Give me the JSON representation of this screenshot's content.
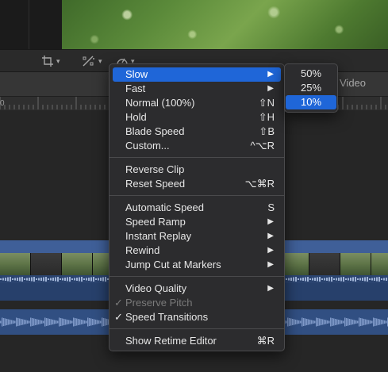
{
  "toolbar": {
    "crop_icon": "crop-icon",
    "transform_icon": "transform-icon",
    "retime_icon": "speedometer-icon"
  },
  "timeline": {
    "ruler_label": "0",
    "video_tab": "Video"
  },
  "speed_menu": {
    "groups": [
      [
        {
          "label": "Slow",
          "submenu": true,
          "selected": true
        },
        {
          "label": "Fast",
          "submenu": true
        },
        {
          "label": "Normal (100%)",
          "shortcut": "⇧N"
        },
        {
          "label": "Hold",
          "shortcut": "⇧H"
        },
        {
          "label": "Blade Speed",
          "shortcut": "⇧B"
        },
        {
          "label": "Custom...",
          "shortcut": "^⌥R"
        }
      ],
      [
        {
          "label": "Reverse Clip"
        },
        {
          "label": "Reset Speed",
          "shortcut": "⌥⌘R"
        }
      ],
      [
        {
          "label": "Automatic Speed",
          "shortcut": "S"
        },
        {
          "label": "Speed Ramp",
          "submenu": true
        },
        {
          "label": "Instant Replay",
          "submenu": true
        },
        {
          "label": "Rewind",
          "submenu": true
        },
        {
          "label": "Jump Cut at Markers",
          "submenu": true
        }
      ],
      [
        {
          "label": "Video Quality",
          "submenu": true
        },
        {
          "label": "Preserve Pitch",
          "checked": true,
          "disabled": true
        },
        {
          "label": "Speed Transitions",
          "checked": true
        }
      ],
      [
        {
          "label": "Show Retime Editor",
          "shortcut": "⌘R"
        }
      ]
    ]
  },
  "slow_submenu": {
    "items": [
      {
        "label": "50%"
      },
      {
        "label": "25%"
      },
      {
        "label": "10%",
        "selected": true
      }
    ]
  },
  "colors": {
    "highlight": "#1f66d8",
    "clip_blue": "#3f5f98",
    "menu_bg": "#2c2c2e"
  }
}
